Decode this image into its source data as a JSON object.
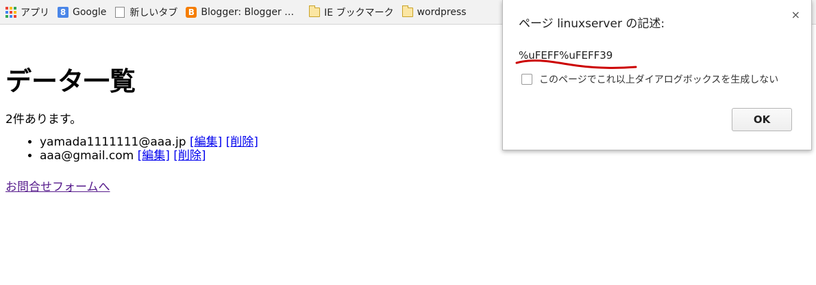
{
  "bookmarks": {
    "items": [
      {
        "label": "アプリ",
        "icon": "apps-grid-icon"
      },
      {
        "label": "Google",
        "icon": "google-icon"
      },
      {
        "label": "新しいタブ",
        "icon": "page-icon"
      },
      {
        "label": "Blogger: Blogger …",
        "icon": "blogger-icon"
      },
      {
        "label": "IE ブックマーク",
        "icon": "folder-icon"
      },
      {
        "label": "wordpress",
        "icon": "folder-icon"
      }
    ],
    "google_letter": "8",
    "blogger_letter": "B"
  },
  "page": {
    "heading": "データ一覧",
    "count_text": "2件あります。",
    "users": [
      {
        "email": "yamada1111111@aaa.jp",
        "edit": "[編集]",
        "delete": "[削除]"
      },
      {
        "email": "aaa@gmail.com",
        "edit": "[編集]",
        "delete": "[削除]"
      }
    ],
    "contact_link": "お問合せフォームへ"
  },
  "dialog": {
    "title": "ページ linuxserver の記述:",
    "close_glyph": "×",
    "message": "%uFEFF%uFEFF39",
    "checkbox_label": "このページでこれ以上ダイアログボックスを生成しない",
    "ok_label": "OK",
    "annotation_color": "#cc0000"
  }
}
